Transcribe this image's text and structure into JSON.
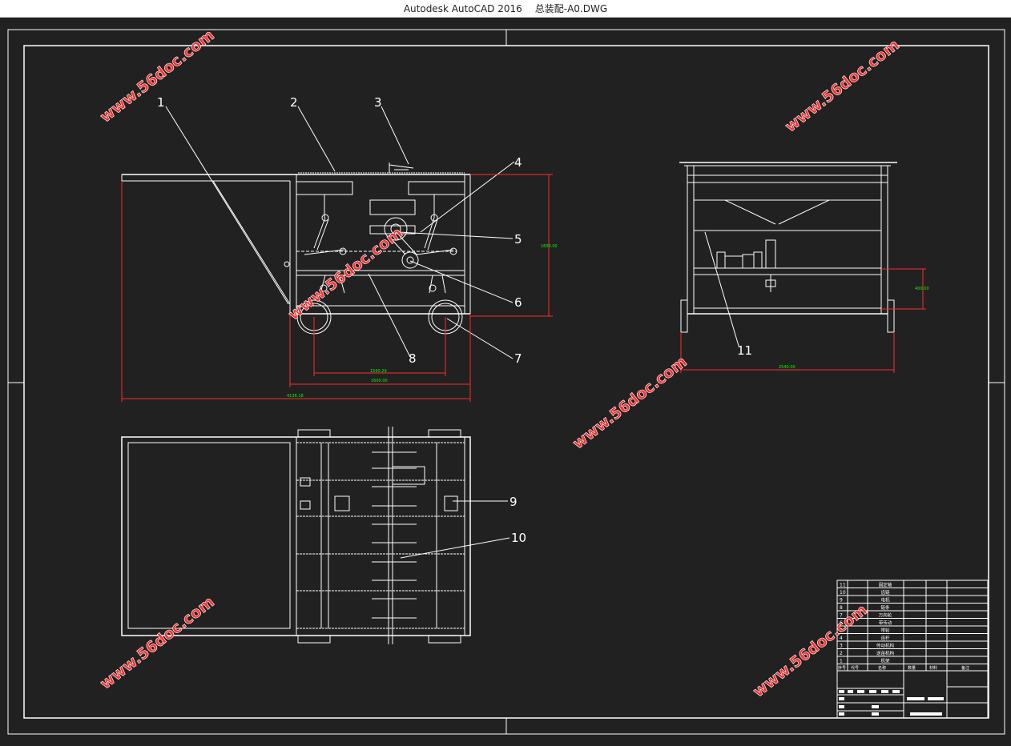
{
  "window": {
    "app_name": "Autodesk AutoCAD 2016",
    "file_name": "总装配-A0.DWG"
  },
  "watermark": {
    "text": "www.56doc.com"
  },
  "callouts": [
    "1",
    "2",
    "3",
    "4",
    "5",
    "6",
    "7",
    "8",
    "9",
    "10",
    "11"
  ],
  "dimensions": {
    "front_height": "1600.00",
    "wheel_spacing": "1560.29",
    "base_length": "1600.00",
    "total_length": "4136.18",
    "side_height": "400.00",
    "side_width": "2540.00"
  },
  "parts_list": {
    "rows": [
      {
        "no": "11",
        "name": "固定轴"
      },
      {
        "no": "10",
        "name": "齿链"
      },
      {
        "no": "9",
        "name": "电机"
      },
      {
        "no": "8",
        "name": "链条"
      },
      {
        "no": "7",
        "name": "万向轮"
      },
      {
        "no": "6",
        "name": "带传动"
      },
      {
        "no": "5",
        "name": "带轮"
      },
      {
        "no": "4",
        "name": "连杆"
      },
      {
        "no": "3",
        "name": "传动机构"
      },
      {
        "no": "2",
        "name": "送苗机构"
      },
      {
        "no": "1",
        "name": "机架"
      }
    ],
    "header": [
      "序号",
      "代号",
      "名称",
      "数量",
      "材料",
      "备注"
    ]
  },
  "colors": {
    "background": "#212121",
    "line": "#ffffff",
    "dimension": "#ff2a2a",
    "dimension_text": "#00ff00",
    "watermark": "#ff3030"
  }
}
